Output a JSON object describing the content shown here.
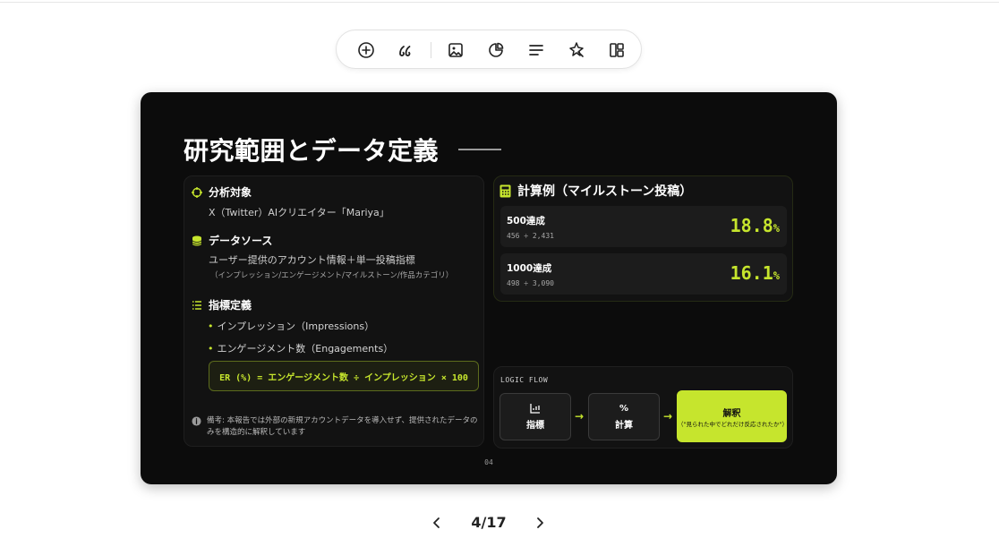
{
  "toolbar": {
    "items": [
      {
        "icon": "plus-circle-icon"
      },
      {
        "icon": "quote-icon"
      },
      {
        "icon": "image-icon"
      },
      {
        "icon": "pie-chart-icon"
      },
      {
        "icon": "text-align-icon"
      },
      {
        "icon": "magic-sparkle-icon"
      },
      {
        "icon": "layout-icon"
      }
    ]
  },
  "slide": {
    "title": "研究範囲とデータ定義",
    "left": {
      "target_heading": "分析対象",
      "target_text": "X（Twitter）AIクリエイター「Mariya」",
      "source_heading": "データソース",
      "source_text": "ユーザー提供のアカウント情報＋単一投稿指標",
      "source_sub": "（インプレッション/エンゲージメント/マイルストーン/作品カテゴリ）",
      "metric_heading": "指標定義",
      "metric_items": [
        "インプレッション（Impressions）",
        "エンゲージメント数（Engagements）"
      ],
      "bullet": "•",
      "formula": "ER (%) = エンゲージメント数 ÷ インプレッション × 100",
      "note": "備考: 本報告では外部の新規アカウントデータを導入せず、提供されたデータのみを構造的に解釈しています"
    },
    "calc": {
      "heading": "計算例（マイルストーン投稿）",
      "cards": [
        {
          "label": "500達成",
          "calc": "456 ÷ 2,431",
          "value": "18.8",
          "unit": "%"
        },
        {
          "label": "1000達成",
          "calc": "498 ÷ 3,090",
          "value": "16.1",
          "unit": "%"
        }
      ]
    },
    "flow": {
      "label": "LOGIC FLOW",
      "steps": [
        {
          "label": "指標",
          "icon": "bar-chart-icon"
        },
        {
          "label": "計算",
          "icon": "percent-icon",
          "glyph": "%"
        },
        {
          "label": "解釈",
          "sub": "（\"見られた中でどれだけ反応されたか\"）"
        }
      ],
      "arrow": "→"
    },
    "page_number": "04"
  },
  "pager": {
    "current": "4/17"
  },
  "colors": {
    "accent": "#c6e52d",
    "slide_bg": "#0c0c0c",
    "panel_bg": "#121212"
  }
}
